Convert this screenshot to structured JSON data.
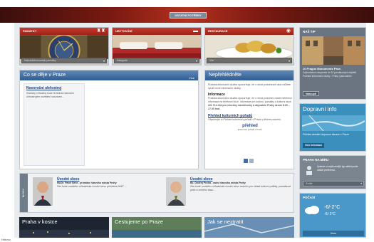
{
  "header": {
    "tab_label": "OSTATNÍ POTŘEBY"
  },
  "categories": [
    {
      "title": "PAMÁTKY",
      "icon": "castle-icon",
      "select": "Nejnavštěvovanější památky"
    },
    {
      "title": "UBYTOVÁNÍ",
      "icon": "bed-icon",
      "select": "Kategorie"
    },
    {
      "title": "RESTAURACE",
      "icon": "restaurant-icon",
      "select": "Vše"
    }
  ],
  "events": {
    "title": "Co se děje v Praze",
    "more": "Více",
    "item_title": "Novoroční ohňostroj",
    "item_text": "Klasický ohňostroj bude tentokrát nahrazen ohňostrojem osvětlení nasvícení..."
  },
  "dontmiss": {
    "title": "Nepřehlédněte",
    "intro": "Pražská informační služba upozorňuje, že v rámci podzimních akcí můžete využít nové informační služby.",
    "info_title": "Informace",
    "info_text": "Pražská informační služba upozorňuje, že v rámci podzimní vlastní telefonní informace na telefonní lince. Informace pro kulturu, památky a kulturní akce.",
    "info_text2": "221 714 444 pro všechny návštěvníky a obyvatele Prahy denně 8.00 – 17.00 hod.",
    "guide_title": "Přehled kulturních pořadů",
    "guide_text": "Objednejte si Přehled kulturních pořadů v Praze s těšíme podzimí.",
    "logo": "přehled",
    "logo_sub": "kulturních pořadů v Praze"
  },
  "word": {
    "side_label": "BLOGY",
    "left_title": "Úvodní slovo",
    "left_name": "MUDr. Pavel Béhr - primátor hlavního města Prahy",
    "left_text": "Zde bude umístěno uživatelské úvodní slovo primátora HMP ...",
    "right_title": "Úvodní slovo",
    "right_name": "Bc. Ondřej Pecha - radní hlavního města Prahy",
    "right_text": "Zde bude umístěno uživatelské úvodní slovo radního pro oblast kulturní politiky, památkové péče a volného času..."
  },
  "sidebar": {
    "tip_title": "NÁŠ TIP",
    "tip_caption": "10 Prague Monuments Pass",
    "tip_text": "Zvýhodněná vstupenka do 10 památkových objektů Pražské informační služby - Prahy i jako dárek!",
    "tip_button": "Nakoupit",
    "traffic_title": "Dopravní info",
    "traffic_text": "Přehled aktuální dopravní situace v Praze",
    "traffic_button": "Více informací",
    "kids_title": "PRAHA NA MÍRU",
    "kids_text": "Vyberte si nejvhodnější typ aktivit podle vašich preferencí.",
    "kids_select": "Zvolte",
    "weather_title": "POČASÍ",
    "weather_today": "Dnes",
    "weather_temp1": "-6/-2°C",
    "weather_temp2": "-6/-1°C",
    "weather_date": "Dnes"
  },
  "bottom": [
    {
      "title": "Praha v kostce"
    },
    {
      "title": "Cestujeme po Praze"
    },
    {
      "title": "Jak se neztratit"
    }
  ],
  "status": "Hotovo"
}
